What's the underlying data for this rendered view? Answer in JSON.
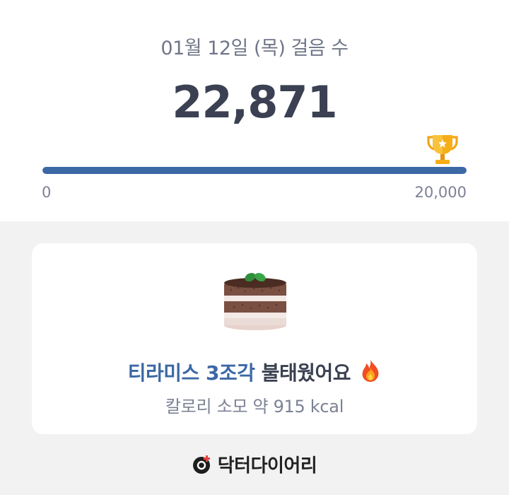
{
  "header": {
    "date_title": "01월 12일 (목) 걸음 수",
    "step_count": "22,871"
  },
  "progress": {
    "min_label": "0",
    "max_label": "20,000",
    "fraction": 1.0,
    "goal_icon": "trophy-icon",
    "bar_color": "#3c68a6"
  },
  "burn_card": {
    "food_icon": "tiramisu-cake-icon",
    "food_text": "티라미스 3조각",
    "action_text": " 불태웠어요",
    "emoji_icon": "fire-icon",
    "calorie_text": "칼로리 소모 약 915 kcal"
  },
  "brand": {
    "logo_icon": "doctor-diary-logo-icon",
    "name": "닥터다이어리"
  },
  "colors": {
    "accent": "#3c68a6",
    "text_dark": "#3b4152",
    "text_muted": "#7b8294",
    "background": "#f2f2f2"
  }
}
